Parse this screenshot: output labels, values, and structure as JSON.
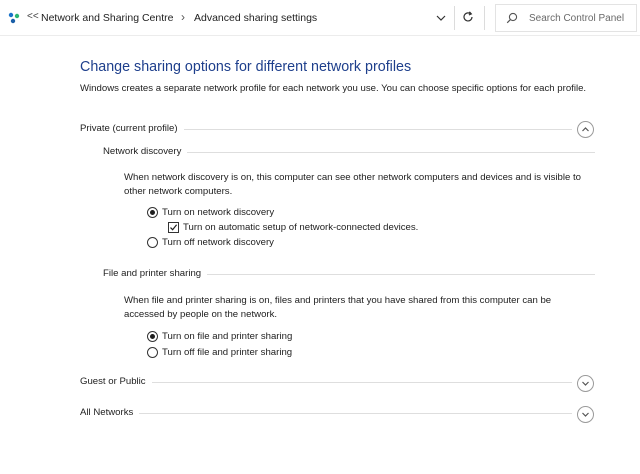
{
  "toolbar": {
    "back_glyph": "<<",
    "breadcrumb": [
      {
        "label": "Network and Sharing Centre"
      },
      {
        "label": "Advanced sharing settings"
      }
    ],
    "separator": "›",
    "search_placeholder": "Search Control Panel"
  },
  "page": {
    "title": "Change sharing options for different network profiles",
    "intro": "Windows creates a separate network profile for each network you use. You can choose specific options for each profile."
  },
  "profiles": [
    {
      "label": "Private (current profile)",
      "expanded": true,
      "sections": [
        {
          "label": "Network discovery",
          "description": "When network discovery is on, this computer can see other network computers and devices and is visible to other network computers.",
          "options": [
            {
              "type": "radio",
              "label": "Turn on network discovery",
              "checked": true
            },
            {
              "type": "checkbox",
              "label": "Turn on automatic setup of network-connected devices.",
              "checked": true
            },
            {
              "type": "radio",
              "label": "Turn off network discovery",
              "checked": false
            }
          ]
        },
        {
          "label": "File and printer sharing",
          "description": "When file and printer sharing is on, files and printers that you have shared from this computer can be accessed by people on the network.",
          "options": [
            {
              "type": "radio",
              "label": "Turn on file and printer sharing",
              "checked": true
            },
            {
              "type": "radio",
              "label": "Turn off file and printer sharing",
              "checked": false
            }
          ]
        }
      ]
    },
    {
      "label": "Guest or Public",
      "expanded": false
    },
    {
      "label": "All Networks",
      "expanded": false
    }
  ],
  "colors": {
    "title": "#1e3f8c",
    "text": "#1e1e1e",
    "divider": "#dedede"
  },
  "icons": {
    "app": "network-center-icon",
    "dropdown": "chevron-down-icon",
    "refresh": "refresh-icon",
    "search": "search-icon",
    "expand": "chevron-up-icon",
    "collapse": "chevron-down-icon"
  }
}
